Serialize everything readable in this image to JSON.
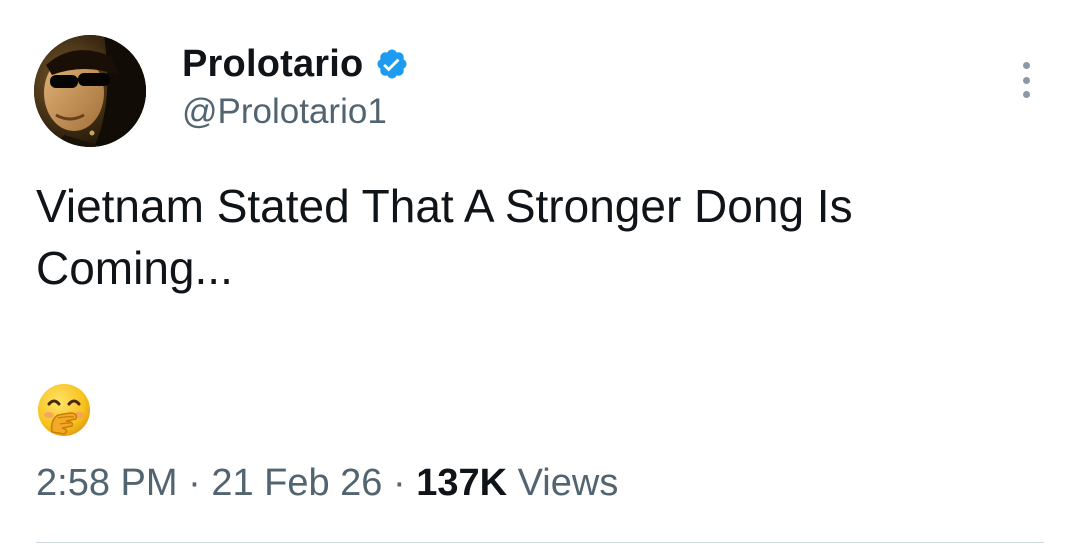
{
  "author": {
    "display_name": "Prolotario",
    "handle": "@Prolotario1",
    "verified": true,
    "avatar_icon": "profile-photo-sunglasses"
  },
  "tweet": {
    "text": "Vietnam Stated That A Stronger Dong Is Coming...",
    "emoji": "hand-over-mouth-emoji"
  },
  "meta": {
    "time": "2:58 PM",
    "separator": "·",
    "date": "21 Feb 26",
    "views_count": "137K",
    "views_label": "Views"
  },
  "colors": {
    "text_primary": "#0f1419",
    "text_secondary": "#536471",
    "verified_blue": "#1d9bf0",
    "divider": "#cfd9de"
  }
}
